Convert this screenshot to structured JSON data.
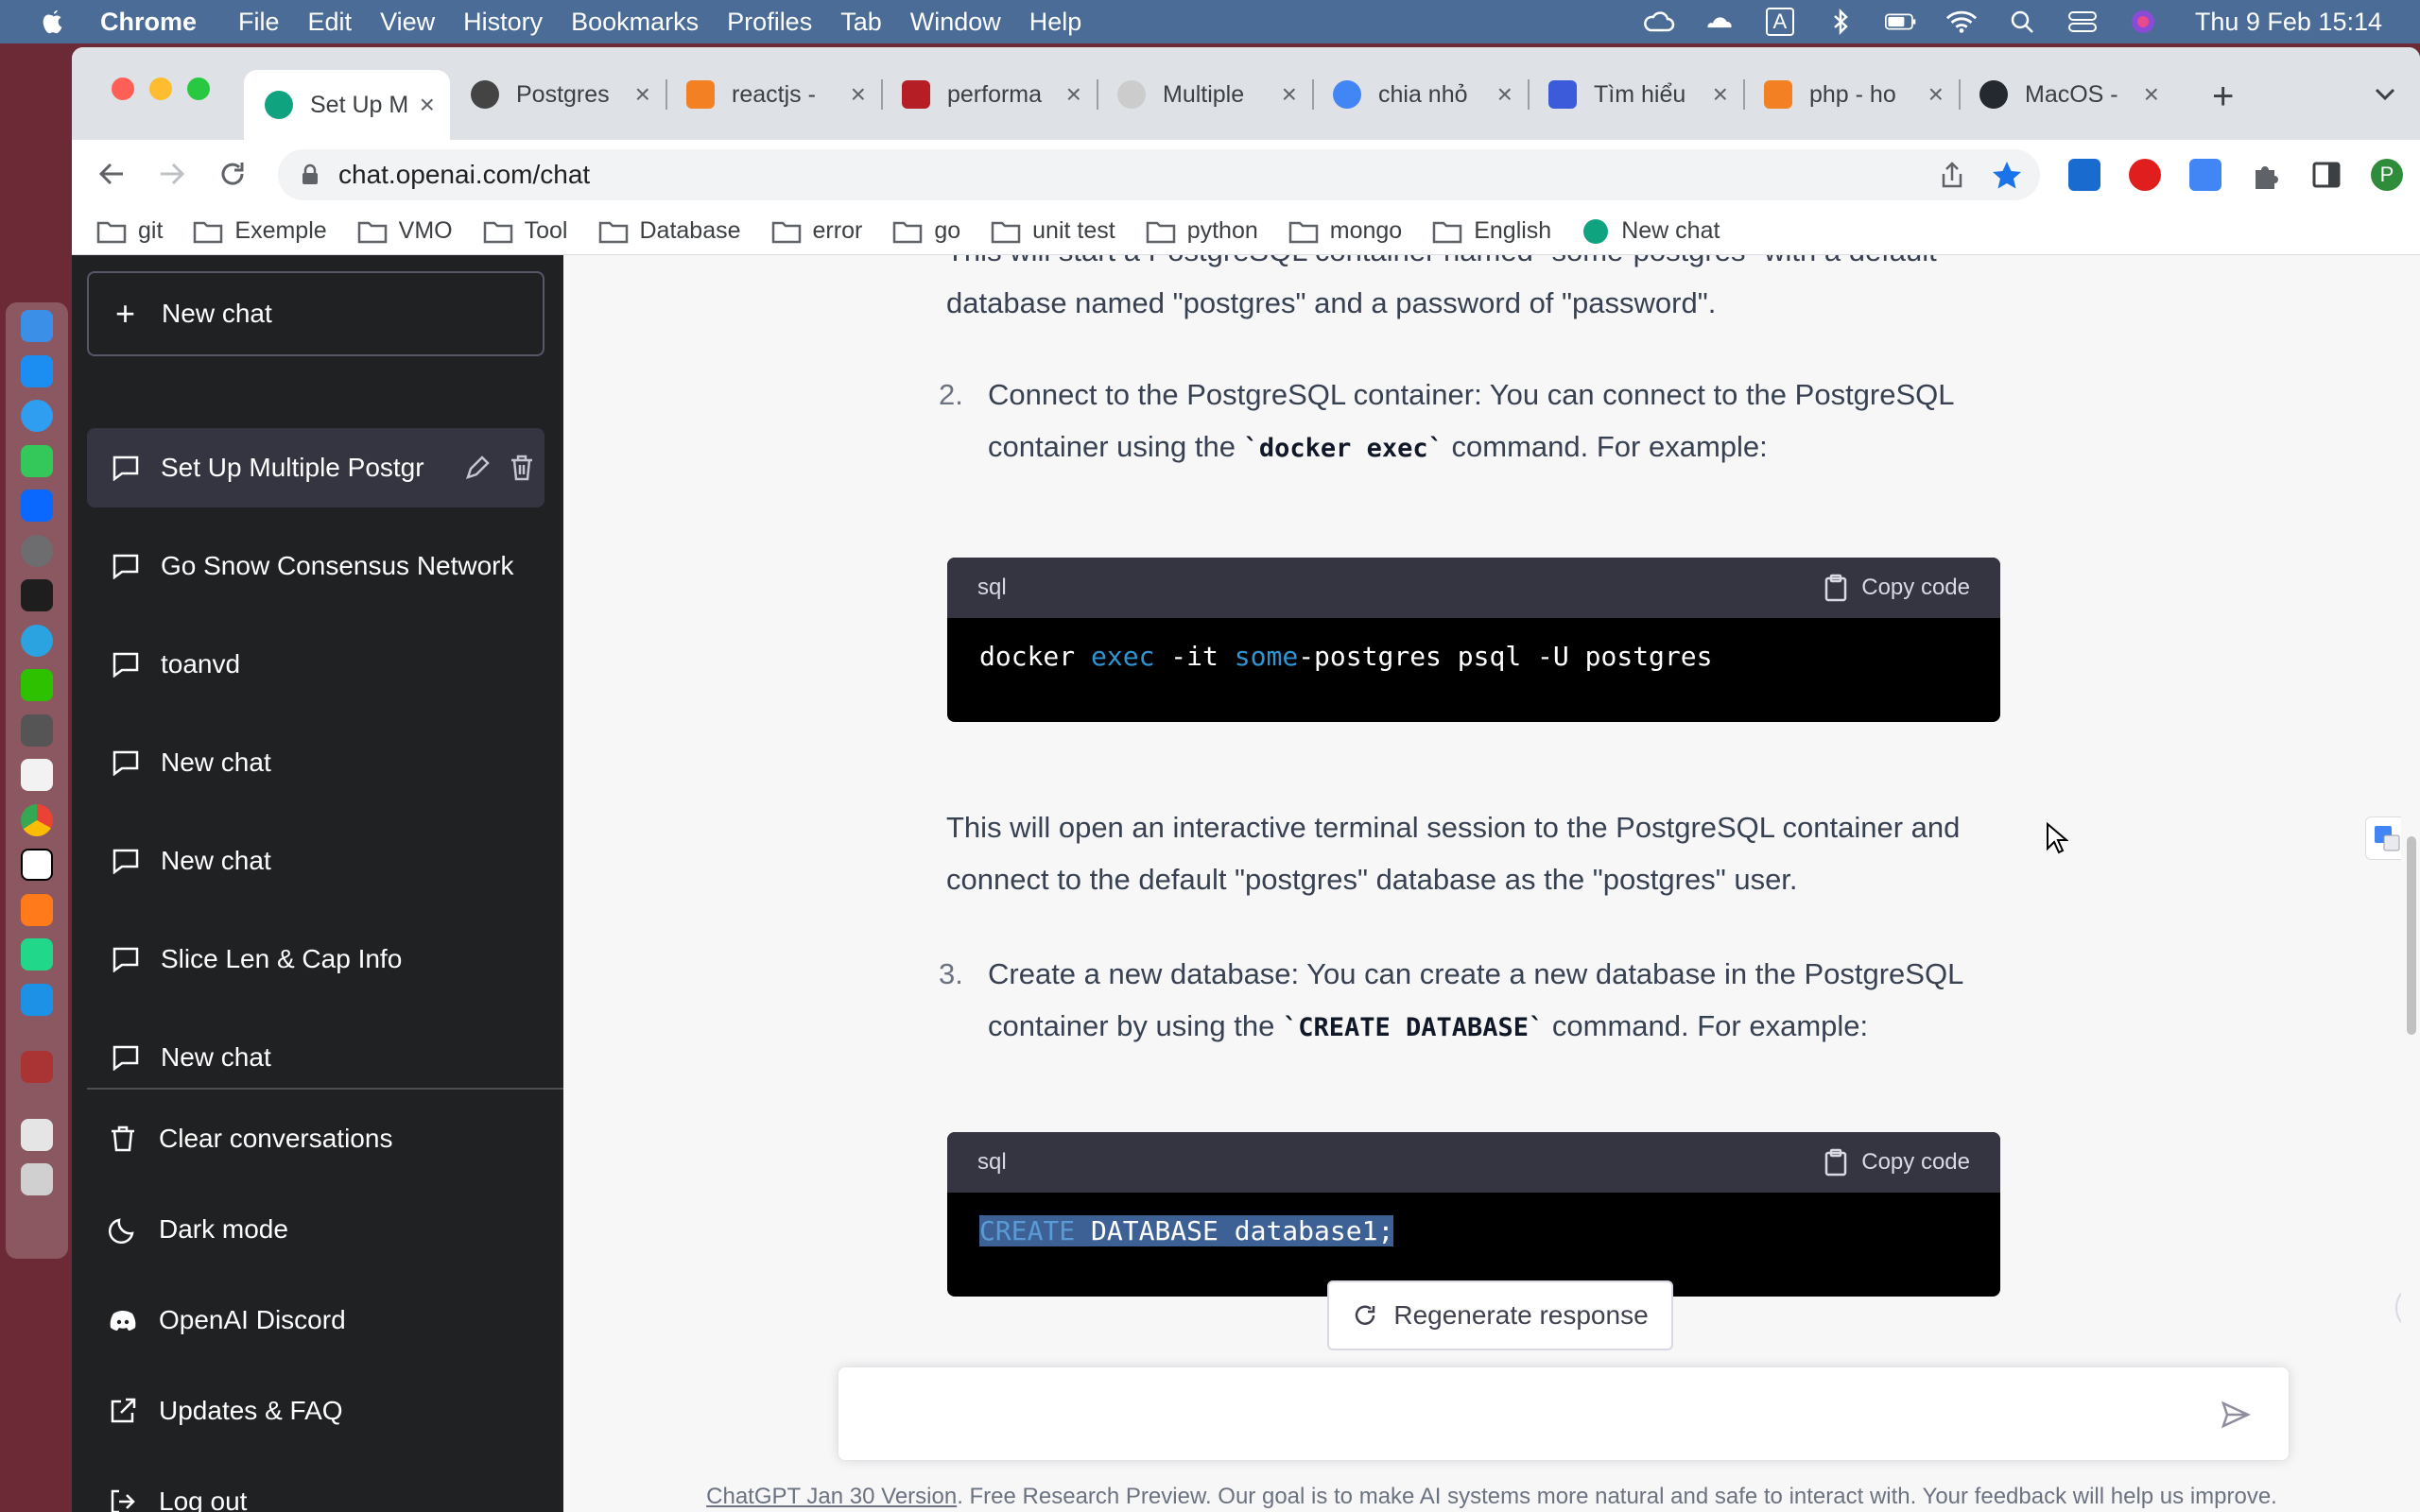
{
  "menubar": {
    "app": "Chrome",
    "items": [
      "File",
      "Edit",
      "View",
      "History",
      "Bookmarks",
      "Profiles",
      "Tab",
      "Window",
      "Help"
    ],
    "clock": "Thu 9 Feb  15:14",
    "input_source": "A"
  },
  "browser": {
    "tabs": [
      {
        "title": "Set Up M",
        "color": "#10a37f",
        "active": true
      },
      {
        "title": "Postgres",
        "color": "#444444"
      },
      {
        "title": "reactjs -",
        "color": "#f48024"
      },
      {
        "title": "performa",
        "color": "#b41e24"
      },
      {
        "title": "Multiple",
        "color": "#cccccc"
      },
      {
        "title": "chia nhỏ",
        "color": "#4285f4"
      },
      {
        "title": "Tìm hiểu",
        "color": "#3b5bdb"
      },
      {
        "title": "php - ho",
        "color": "#f48024"
      },
      {
        "title": "MacOS -",
        "color": "#24292f"
      }
    ],
    "url": "chat.openai.com/chat",
    "profile_initial": "P",
    "bookmarks": [
      "git",
      "Exemple",
      "VMO",
      "Tool",
      "Database",
      "error",
      "go",
      "unit test",
      "python",
      "mongo",
      "English",
      "New chat"
    ]
  },
  "sidebar": {
    "new_chat": "New chat",
    "conversations": [
      {
        "label": "Set Up Multiple Postgr",
        "active": true
      },
      {
        "label": "Go Snow Consensus Network"
      },
      {
        "label": "toanvd"
      },
      {
        "label": "New chat"
      },
      {
        "label": "New chat"
      },
      {
        "label": "Slice Len & Cap Info"
      },
      {
        "label": "New chat"
      }
    ],
    "bottom": [
      "Clear conversations",
      "Dark mode",
      "OpenAI Discord",
      "Updates & FAQ",
      "Log out"
    ]
  },
  "content": {
    "cut_line": "This will start a PostgreSQL container named \"some-postgres\" with a default",
    "para1_line2": "database named \"postgres\" and a password of \"password\".",
    "step2": {
      "num": "2.",
      "text_a": "Connect to the PostgreSQL container: You can connect to the PostgreSQL container using the ",
      "code": "`docker exec`",
      "text_b": " command. For example:"
    },
    "code1": {
      "lang": "sql",
      "copy": "Copy code",
      "tokens": [
        "docker ",
        "exec",
        " -it ",
        "some",
        "-postgres psql -U postgres"
      ]
    },
    "para2": "This will open an interactive terminal session to the PostgreSQL container and connect to the default \"postgres\" database as the \"postgres\" user.",
    "step3": {
      "num": "3.",
      "text_a": "Create a new database: You can create a new database in the PostgreSQL container by using the ",
      "code": "`CREATE DATABASE`",
      "text_b": " command. For example:"
    },
    "code2": {
      "lang": "sql",
      "copy": "Copy code",
      "tokens": [
        "CREATE",
        " DATABASE database1;"
      ]
    }
  },
  "composer": {
    "regenerate": "Regenerate response",
    "placeholder": "",
    "footer_link": "ChatGPT Jan 30 Version",
    "footer_text": ". Free Research Preview. Our goal is to make AI systems more natural and safe to interact with. Your feedback will help us improve."
  },
  "colors": {
    "sidebar_bg": "#202123",
    "main_bg": "#f7f7f8",
    "code_bg": "#000000",
    "code_header": "#343541",
    "keyword": "#2e95d3"
  }
}
